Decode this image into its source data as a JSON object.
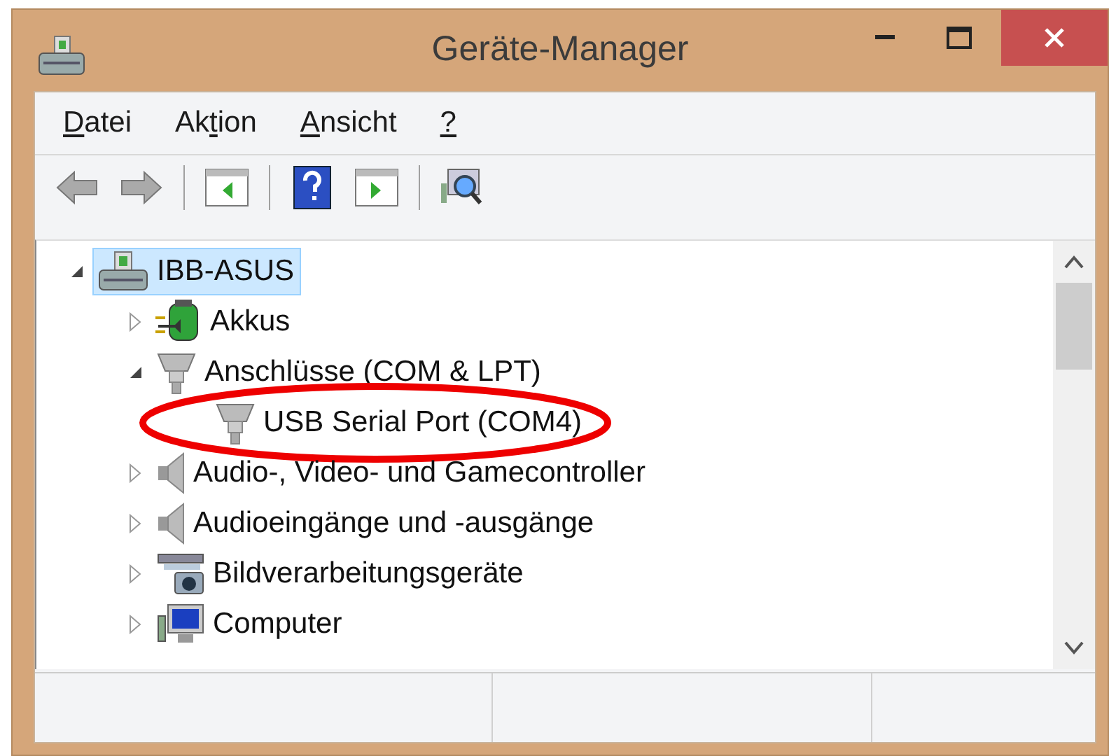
{
  "window": {
    "title": "Geräte-Manager"
  },
  "menu": [
    {
      "access_key": "D",
      "after": "atei"
    },
    {
      "before": "Ak",
      "access_key": "t",
      "after": "ion"
    },
    {
      "access_key": "A",
      "after": "nsicht"
    },
    {
      "access_key": "?"
    }
  ],
  "tree": [
    {
      "label": "IBB-ASUS",
      "kind": "computer",
      "selected": true,
      "expanded": true,
      "children": [
        {
          "label": "Akkus",
          "kind": "battery",
          "selected": false,
          "expanded": false
        },
        {
          "label": "Anschlüsse (COM & LPT)",
          "kind": "port",
          "selected": false,
          "expanded": true,
          "children": [
            {
              "label": "USB Serial Port (COM4)",
              "kind": "port",
              "selected": false,
              "circled": true
            }
          ]
        },
        {
          "label": "Audio-, Video- und Gamecontroller",
          "kind": "speaker",
          "selected": false,
          "expanded": false
        },
        {
          "label": "Audioeingänge und -ausgänge",
          "kind": "speaker",
          "selected": false,
          "expanded": false
        },
        {
          "label": "Bildverarbeitungsgeräte",
          "kind": "camera",
          "selected": false,
          "expanded": false
        },
        {
          "label": "Computer",
          "kind": "monitor",
          "selected": false,
          "expanded": false
        }
      ]
    }
  ]
}
